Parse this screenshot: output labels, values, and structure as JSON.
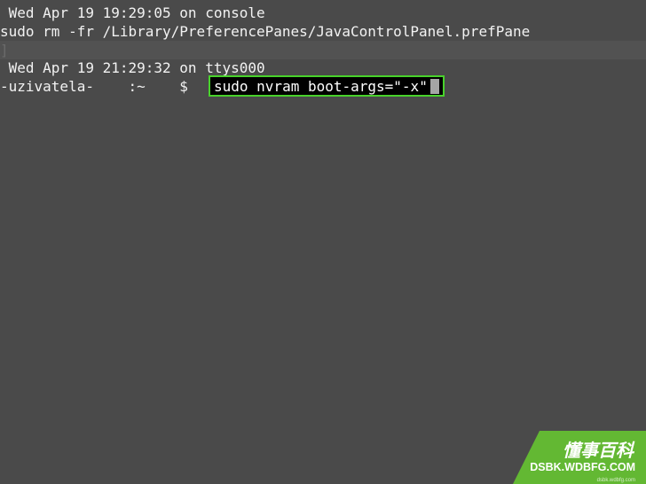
{
  "terminal": {
    "lines": [
      " Wed Apr 19 19:29:05 on console",
      "sudo rm -fr /Library/PreferencePanes/JavaControlPanel.prefPane",
      "]",
      " Wed Apr 19 21:29:32 on ttys000"
    ],
    "prompt": "-uzivatela-    :~    $",
    "command": "sudo nvram boot-args=\"-x\""
  },
  "watermark": {
    "cn": "懂事百科",
    "url": "DSBK.WDBFG.COM",
    "sub": "dsbk.wdbfg.com"
  },
  "colors": {
    "background": "#4a4a4a",
    "highlight_border": "#48d22b",
    "brand": "#63b833"
  }
}
